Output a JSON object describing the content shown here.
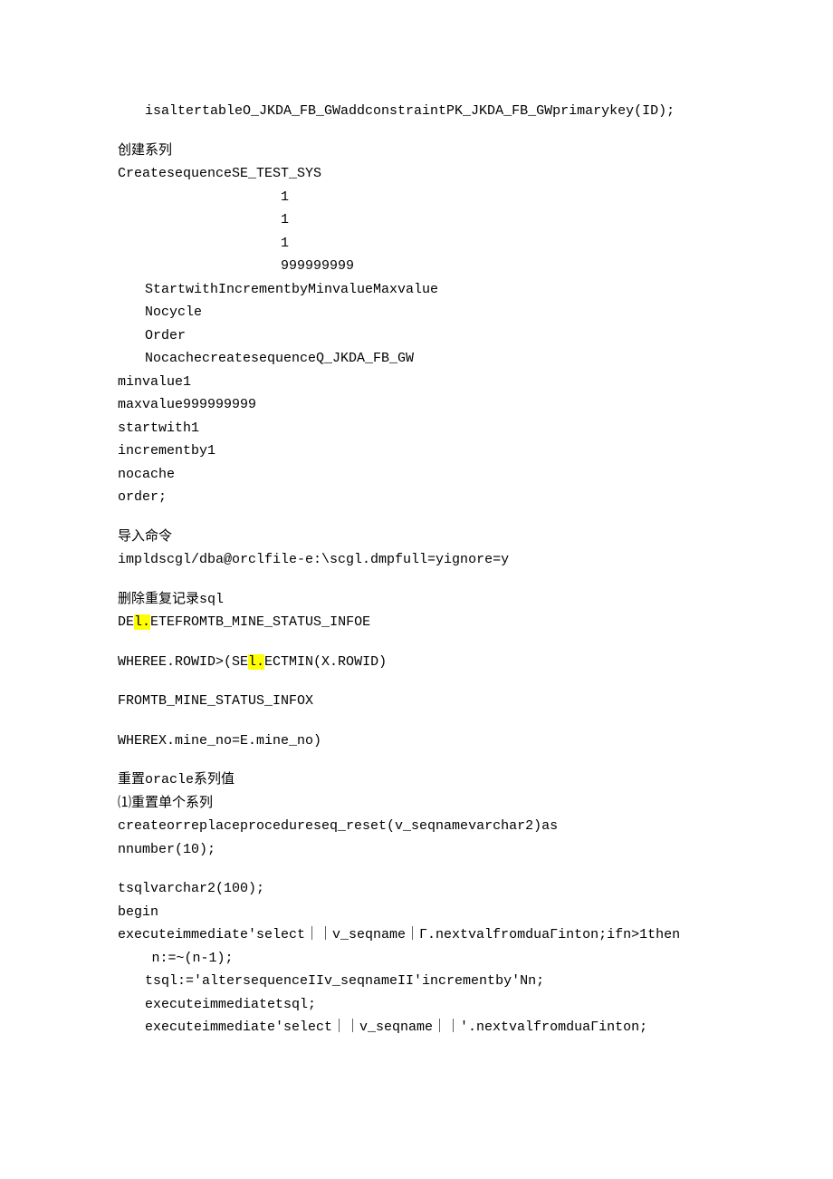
{
  "line1": "isaltertableO_JKDA_FB_GWaddconstraintPK_JKDA_FB_GWprimarykey(ID);",
  "sec1_title": "创建系列",
  "sec1_l1": "CreatesequenceSE_TEST_SYS",
  "sec1_num1": "1",
  "sec1_num2": "1",
  "sec1_num3": "1",
  "sec1_num4": "999999999",
  "sec1_l2": "StartwithIncrementbyMinvalueMaxvalue",
  "sec1_l3": "Nocycle",
  "sec1_l4": "Order",
  "sec1_l5": "NocachecreatesequenceQ_JKDA_FB_GW",
  "sec1_l6": "minvalue1",
  "sec1_l7": "maxvalue999999999",
  "sec1_l8": "startwith1",
  "sec1_l9": "incrementby1",
  "sec1_l10": "nocache",
  "sec1_l11": "order;",
  "sec2_title": "导入命令",
  "sec2_l1": "impldscgl/dba@orclfile-e:\\scgl.dmpfull=yignore=y",
  "sec3_title": "删除重复记录sql",
  "sec3_l1a": "DE",
  "sec3_l1h": "l.",
  "sec3_l1b": "ETEFROMTB_MINE_STATUS_INFOE",
  "sec3_l2a": "WHEREE.ROWID>(SE",
  "sec3_l2h": "l.",
  "sec3_l2b": "ECTMIN(X.ROWID)",
  "sec3_l3": "FROMTB_MINE_STATUS_INFOX",
  "sec3_l4": "WHEREX.mine_no=E.mine_no)",
  "sec4_title": "重置oracle系列值",
  "sec4_sub": "⑴重置单个系列",
  "sec4_l1": "createorreplaceprocedureseq_reset(v_seqnamevarchar2)as",
  "sec4_l2": "nnumber(10);",
  "sec4_l3": "tsqlvarchar2(100);",
  "sec4_l4": "begin",
  "sec4_l5": "executeimmediate'select｜｜v_seqname｜Γ.nextvalfromduaΓinton;ifn>1then",
  "sec4_l6": "n:=~(n-1);",
  "sec4_l7": "tsql:='altersequenceIIv_seqnameII'incrementby'Nn;",
  "sec4_l8": "executeimmediatetsql;",
  "sec4_l9": "executeimmediate'select｜｜v_seqname｜｜'.nextvalfromduaΓinton;"
}
